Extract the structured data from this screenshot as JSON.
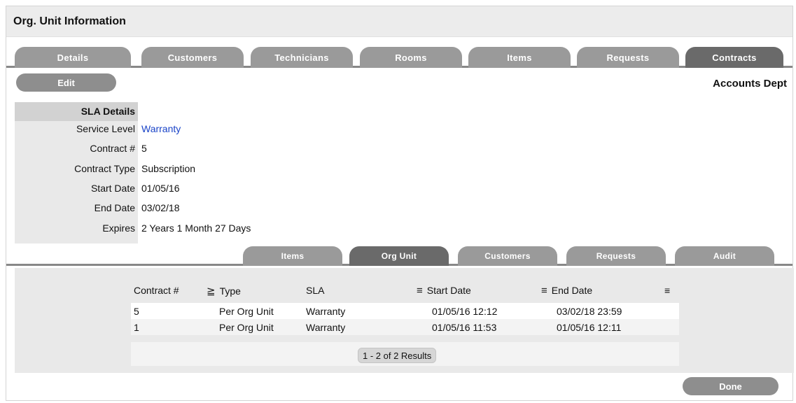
{
  "header": {
    "title": "Org. Unit Information"
  },
  "top_tabs": [
    {
      "label": "Details"
    },
    {
      "label": "Customers"
    },
    {
      "label": "Technicians"
    },
    {
      "label": "Rooms"
    },
    {
      "label": "Items"
    },
    {
      "label": "Requests"
    },
    {
      "label": "Contracts",
      "active": true
    }
  ],
  "edit_label": "Edit",
  "org_name": "Accounts Dept",
  "sla": {
    "heading": "SLA Details",
    "rows": [
      {
        "label": "Service Level",
        "value": "Warranty"
      },
      {
        "label": "Contract #",
        "value": "5"
      },
      {
        "label": "Contract Type",
        "value": "Subscription"
      },
      {
        "label": "Start Date",
        "value": "01/05/16"
      },
      {
        "label": "End Date",
        "value": "03/02/18"
      },
      {
        "label": "Expires",
        "value": "2 Years 1 Month 27 Days"
      }
    ]
  },
  "bottom_tabs": [
    {
      "label": "Items"
    },
    {
      "label": "Org Unit",
      "active": true
    },
    {
      "label": "Customers"
    },
    {
      "label": "Requests"
    },
    {
      "label": "Audit"
    }
  ],
  "table": {
    "columns": [
      "Contract #",
      "Type",
      "SLA",
      "Start Date",
      "End Date"
    ],
    "icons": {
      "filter": "filter-icon",
      "column_menu": "column-menu-icon"
    },
    "rows": [
      [
        "5",
        "Per Org Unit",
        "Warranty",
        "01/05/16 12:12",
        "03/02/18 23:59"
      ],
      [
        "1",
        "Per Org Unit",
        "Warranty",
        "01/05/16 11:53",
        "01/05/16 12:11"
      ]
    ],
    "results": "1 - 2 of 2 Results"
  },
  "done_label": "Done"
}
